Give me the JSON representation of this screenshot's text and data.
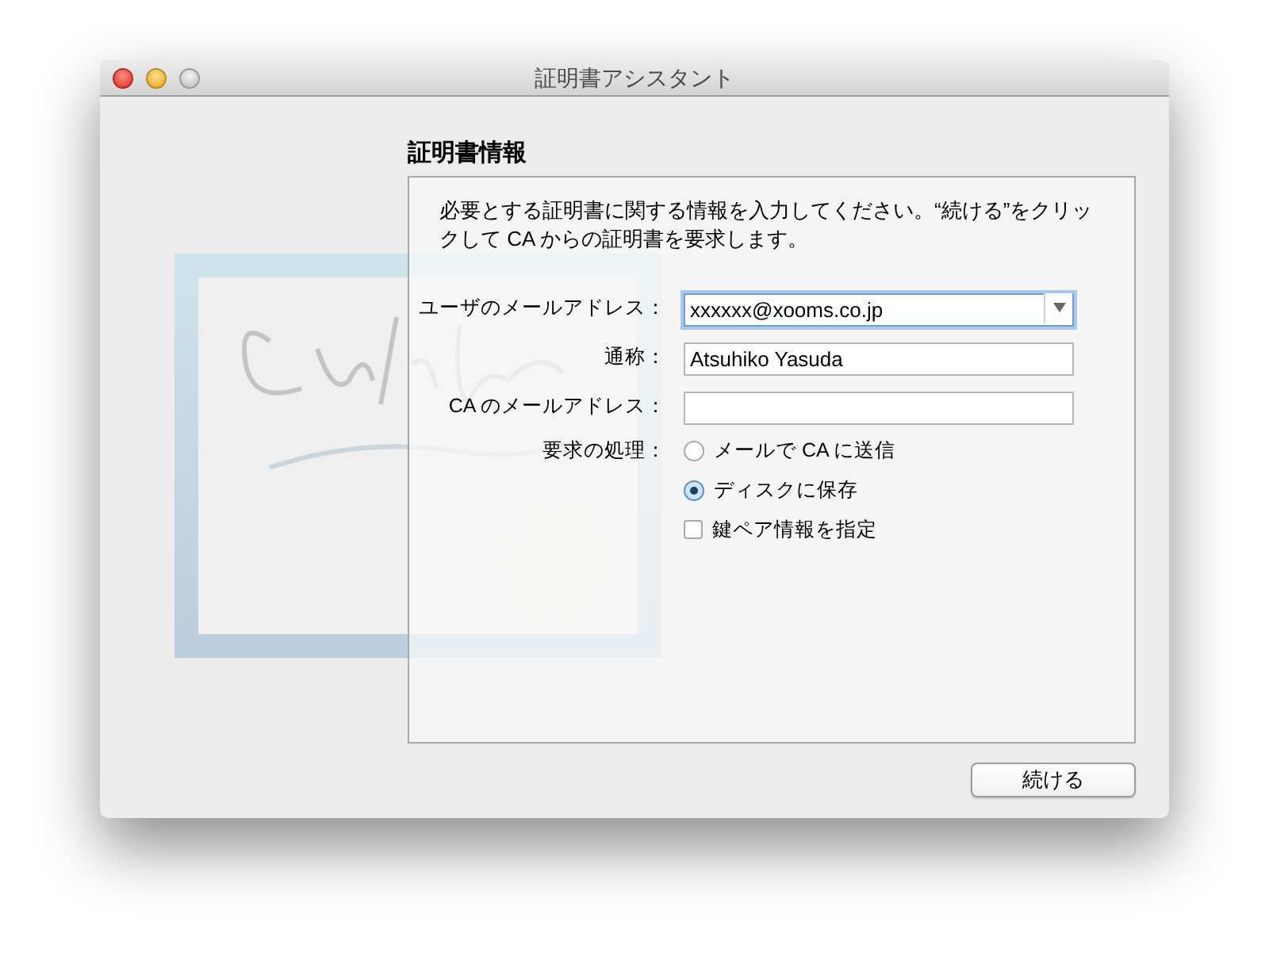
{
  "window": {
    "title": "証明書アシスタント"
  },
  "section_title": "証明書情報",
  "description": "必要とする証明書に関する情報を入力してください。“続ける”をクリックして CA からの証明書を要求します。",
  "fields": [
    {
      "kind": "combo",
      "label": "ユーザのメールアドレス：",
      "value": "xxxxxx@xooms.co.jp",
      "focused": true
    },
    {
      "kind": "text",
      "label": "通称：",
      "value": "Atsuhiko Yasuda",
      "focused": false
    },
    {
      "kind": "text",
      "label": "CA のメールアドレス：",
      "focused": false
    }
  ],
  "request": {
    "label": "要求の処理：",
    "options": [
      {
        "label": "メールで CA に送信",
        "selected": false
      },
      {
        "label": "ディスクに保存",
        "selected": true
      }
    ]
  },
  "key_pair": {
    "label": "鍵ペア情報を指定",
    "checked": false
  },
  "buttons": [
    {
      "label": "続ける"
    }
  ]
}
